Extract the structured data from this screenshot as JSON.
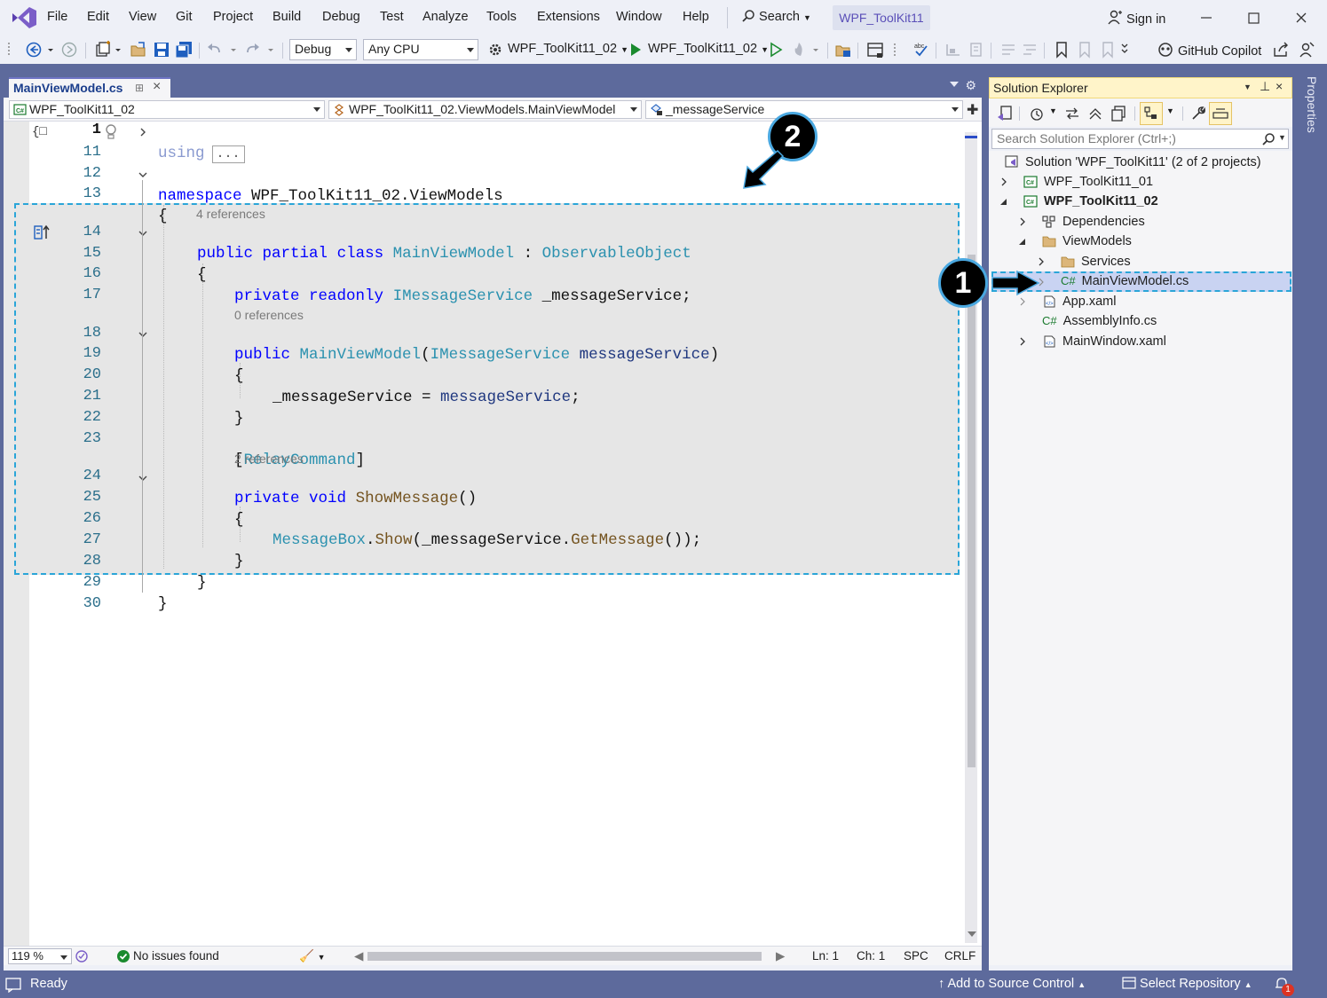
{
  "title_bar": {
    "menu": [
      "File",
      "Edit",
      "View",
      "Git",
      "Project",
      "Build",
      "Debug",
      "Test",
      "Analyze",
      "Tools",
      "Extensions",
      "Window",
      "Help"
    ],
    "search_label": "Search",
    "solution_name": "WPF_ToolKit11",
    "sign_in_label": "Sign in"
  },
  "toolbar": {
    "configuration": "Debug",
    "platform": "Any CPU",
    "startup_project": "WPF_ToolKit11_02",
    "run_target": "WPF_ToolKit11_02",
    "copilot_label": "GitHub Copilot"
  },
  "document_tab": {
    "label": "MainViewModel.cs"
  },
  "navigation_bar": {
    "project": "WPF_ToolKit11_02",
    "type": "WPF_ToolKit11_02.ViewModels.MainViewModel",
    "member": "_messageService"
  },
  "code": {
    "using_keyword": "using",
    "using_collapsed": "...",
    "line_numbers": [
      "1",
      "11",
      "12",
      "13",
      "14",
      "15",
      "16",
      "17",
      "18",
      "19",
      "20",
      "21",
      "22",
      "23",
      "24",
      "25",
      "26",
      "27",
      "28",
      "29",
      "30"
    ],
    "lens": {
      "class_refs": "4 references",
      "ctor_refs": "0 references",
      "method_refs": "2 references"
    },
    "tokens": {
      "namespace_kw": "namespace",
      "namespace_name": "WPF_ToolKit11_02.ViewModels",
      "open_brace": "{",
      "close_brace": "}",
      "public_kw": "public",
      "partial_kw": "partial",
      "class_kw": "class",
      "class_name": "MainViewModel",
      "colon": ":",
      "base_class": "ObservableObject",
      "private_kw": "private",
      "readonly_kw": "readonly",
      "interface_name": "IMessageService",
      "field_decl": "_messageService;",
      "ctor_name": "MainViewModel",
      "ctor_open": "(",
      "param_name": "messageService",
      "ctor_close": ")",
      "field_name": "_messageService",
      "assign": " = ",
      "param_ref": "messageService",
      "semicolon": ";",
      "attr_open": "[",
      "attr_name": "RelayCommand",
      "attr_close": "]",
      "void_kw": "void",
      "method_name": "ShowMessage",
      "method_parens": "()",
      "msgbox_type": "MessageBox",
      "dot": ".",
      "show_method": "Show",
      "show_open": "(",
      "field_ref": "_messageService",
      "getmessage": "GetMessage",
      "call_close": "());"
    }
  },
  "editor_status": {
    "zoom": "119 %",
    "issues": "No issues found",
    "ln": "Ln: 1",
    "ch": "Ch: 1",
    "whitespace": "SPC",
    "line_ending": "CRLF"
  },
  "solution_explorer": {
    "title": "Solution Explorer",
    "search_placeholder": "Search Solution Explorer (Ctrl+;)",
    "solution_node": "Solution 'WPF_ToolKit11' (2 of 2 projects)",
    "project1": "WPF_ToolKit11_01",
    "project2": "WPF_ToolKit11_02",
    "dependencies": "Dependencies",
    "viewmodels_folder": "ViewModels",
    "services_folder": "Services",
    "selected_file": "MainViewModel.cs",
    "app_xaml": "App.xaml",
    "assembly_info": "AssemblyInfo.cs",
    "mainwindow_xaml": "MainWindow.xaml"
  },
  "side_panel_label": "Properties",
  "status_bar": {
    "ready": "Ready",
    "add_source_control": "Add to Source Control",
    "select_repository": "Select Repository",
    "notification_count": "1"
  },
  "callouts": [
    "1",
    "2"
  ],
  "colors": {
    "accent": "#5d6a9c",
    "highlight_border": "#2aa5d8",
    "keyword": "#0000ff",
    "type": "#2b91af"
  }
}
